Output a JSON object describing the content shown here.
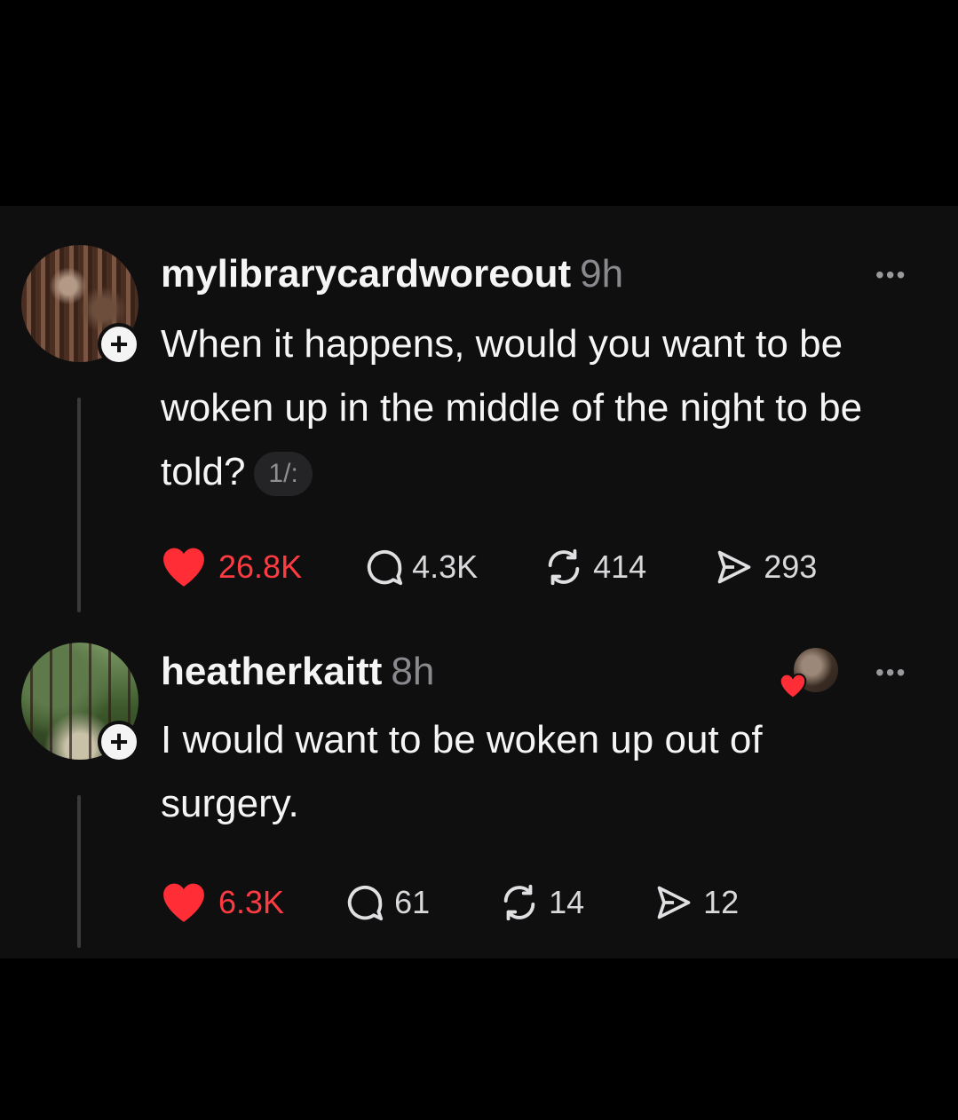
{
  "colors": {
    "background": "#000000",
    "panel": "#0f0f10",
    "text": "#f5f5f5",
    "muted": "#8a8a8e",
    "like": "#ff2d36"
  },
  "posts": [
    {
      "username": "mylibrarycardworeout",
      "time": "9h",
      "text": "When it happens, would you want to be woken up in the middle of the night to be told?",
      "page_badge": "1/:",
      "avatar": "library-photo",
      "icons": {
        "follow": "plus-icon",
        "more": "more-icon"
      },
      "actions": {
        "likes": "26.8K",
        "replies": "4.3K",
        "reposts": "414",
        "shares": "293"
      },
      "liked": true
    },
    {
      "username": "heatherkaitt",
      "time": "8h",
      "text": "I would want to be woken up out of surgery.",
      "avatar": "forest-photo",
      "liked_by_author": true,
      "icons": {
        "follow": "plus-icon",
        "more": "more-icon"
      },
      "actions": {
        "likes": "6.3K",
        "replies": "61",
        "reposts": "14",
        "shares": "12"
      },
      "liked": true
    }
  ],
  "more_glyph": "•••",
  "plus_glyph": "+"
}
